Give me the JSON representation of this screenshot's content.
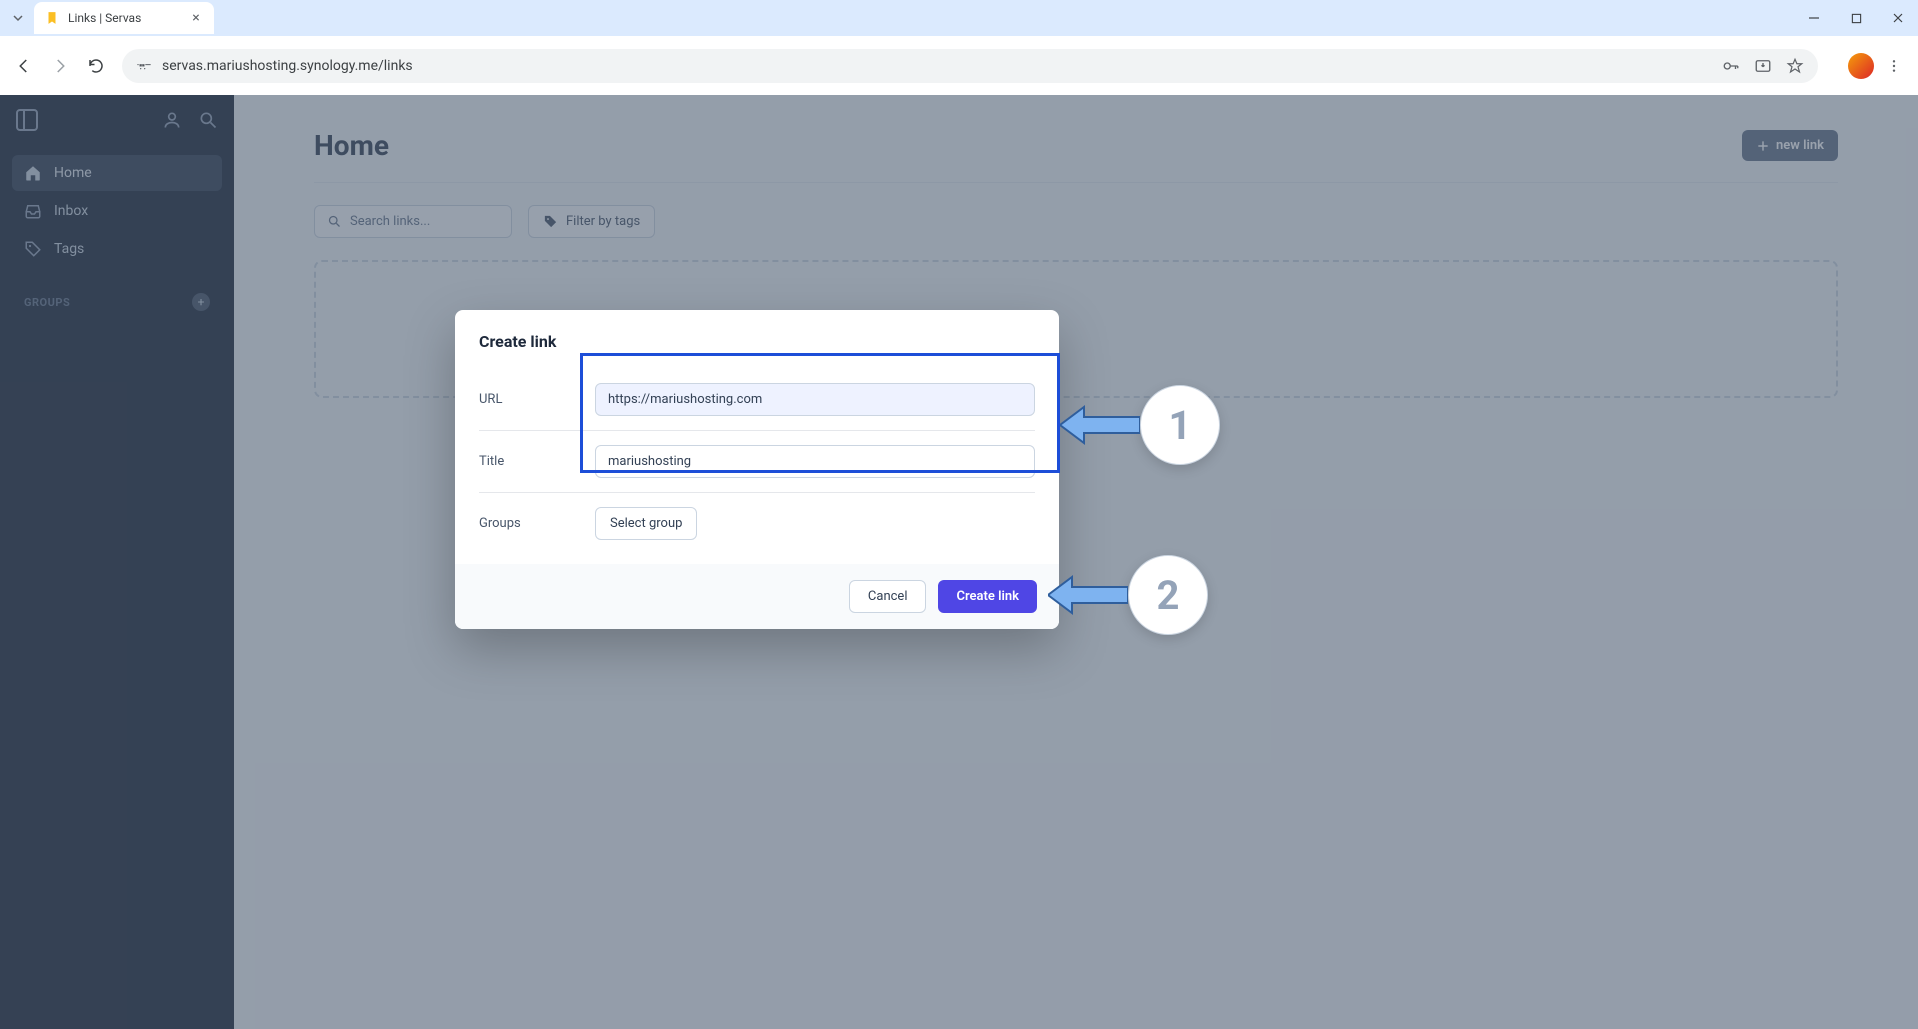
{
  "browser": {
    "tab_title": "Links | Servas",
    "url": "servas.mariushosting.synology.me/links"
  },
  "sidebar": {
    "nav": [
      {
        "label": "Home",
        "icon": "home-icon",
        "active": true
      },
      {
        "label": "Inbox",
        "icon": "inbox-icon",
        "active": false
      },
      {
        "label": "Tags",
        "icon": "tag-icon",
        "active": false
      }
    ],
    "groups_label": "GROUPS"
  },
  "page": {
    "title": "Home",
    "new_link_label": "new link",
    "search_placeholder": "Search links...",
    "filter_tags_label": "Filter by tags"
  },
  "modal": {
    "title": "Create link",
    "url_label": "URL",
    "url_value": "https://mariushosting.com",
    "title_label": "Title",
    "title_value": "mariushosting",
    "groups_label": "Groups",
    "select_group_label": "Select group",
    "cancel_label": "Cancel",
    "submit_label": "Create link"
  },
  "annotations": {
    "step1": "1",
    "step2": "2"
  }
}
